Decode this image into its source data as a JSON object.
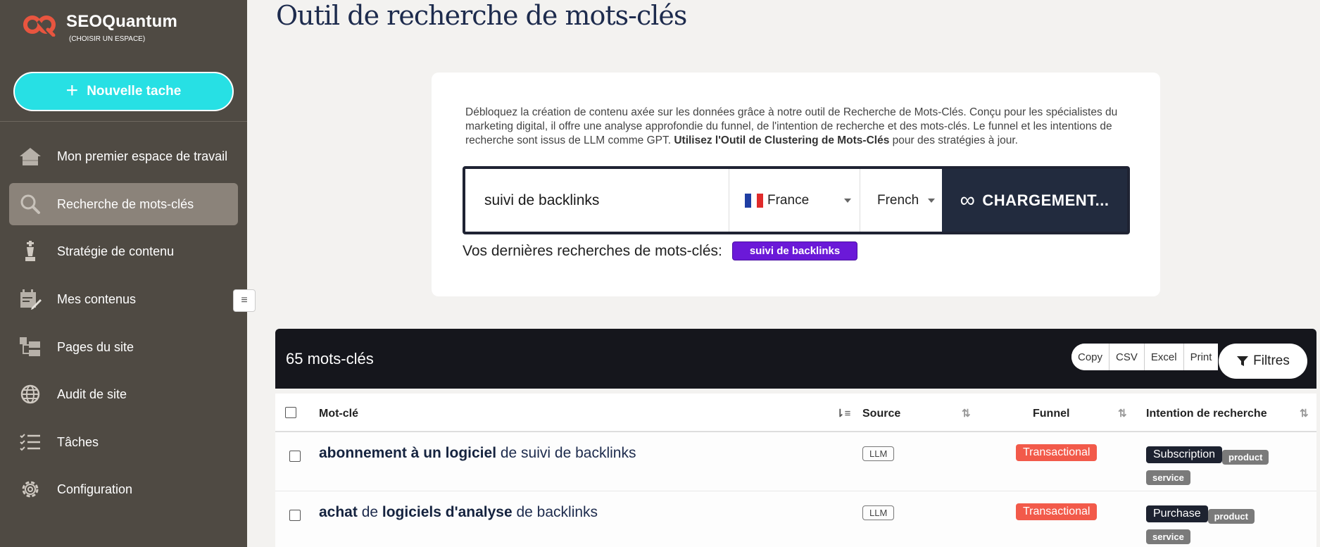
{
  "brand": {
    "name": "SEOQuantum",
    "sub": "(CHOISIR UN ESPACE)"
  },
  "sidebar": {
    "new_task": "Nouvelle tache",
    "items": [
      {
        "label": "Mon premier espace de travail",
        "icon": "home-icon"
      },
      {
        "label": "Recherche de mots-clés",
        "icon": "search-icon",
        "active": true
      },
      {
        "label": "Stratégie de contenu",
        "icon": "chess-icon"
      },
      {
        "label": "Mes contenus",
        "icon": "edit-calendar-icon"
      },
      {
        "label": "Pages du site",
        "icon": "sitemap-icon"
      },
      {
        "label": "Audit de site",
        "icon": "globe-icon"
      },
      {
        "label": "Tâches",
        "icon": "checklist-icon"
      },
      {
        "label": "Configuration",
        "icon": "gear-icon"
      }
    ],
    "collapse": "≡"
  },
  "main": {
    "title": "Outil de recherche de mots-clés",
    "desc_1": "Débloquez la création de contenu axée sur les données grâce à notre outil de Recherche de Mots-Clés. Conçu pour les spécialistes du marketing digital, il offre une analyse approfondie du funnel, de l'intention de recherche et des mots-clés. Le funnel et les intentions de recherche sont issus de LLM comme GPT. ",
    "desc_bold": "Utilisez l'Outil de Clustering de Mots-Clés",
    "desc_2": " pour des stratégies à jour.",
    "search_value": "suivi de backlinks",
    "country": "France",
    "language": "French",
    "load_button": "CHARGEMENT...",
    "recent_label": "Vos dernières recherches de mots-clés:",
    "recent_tag": "suivi de backlinks"
  },
  "table": {
    "count": "65 mots-clés",
    "exports": [
      "Copy",
      "CSV",
      "Excel",
      "Print"
    ],
    "filters": "Filtres",
    "headers": {
      "keyword": "Mot-clé",
      "source": "Source",
      "funnel": "Funnel",
      "intent": "Intention de recherche"
    },
    "rows": [
      {
        "kw_b1": "abonnement à un logiciel",
        "kw_t1": " de suivi de backlinks",
        "kw_b2": "",
        "kw_t2": "",
        "source": "LLM",
        "funnel": "Transactional",
        "intent": "Subscription",
        "tag1": "product",
        "tag2": "service"
      },
      {
        "kw_b1": "achat",
        "kw_t1": " de ",
        "kw_b2": "logiciels d'analyse",
        "kw_t2": " de backlinks",
        "source": "LLM",
        "funnel": "Transactional",
        "intent": "Purchase",
        "tag1": "product",
        "tag2": "service"
      }
    ]
  },
  "colors": {
    "sidebar": "#4f4a43",
    "accent": "#27e0e4",
    "purple": "#6b19d8",
    "funnel": "#f25a4a"
  }
}
